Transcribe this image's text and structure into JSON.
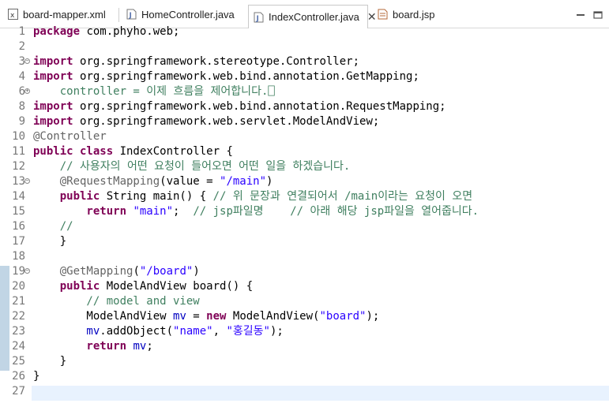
{
  "tabs": [
    {
      "label": "board-mapper.xml",
      "icon": "xml-file-icon",
      "active": false
    },
    {
      "label": "HomeController.java",
      "icon": "java-file-icon",
      "active": false
    },
    {
      "label": "IndexController.java",
      "icon": "java-file-icon",
      "active": true
    },
    {
      "label": "board.jsp",
      "icon": "jsp-file-icon",
      "active": false
    }
  ],
  "close_glyph": "✕",
  "lines": [
    {
      "n": "1",
      "parts": [
        [
          "kw",
          "package"
        ],
        [
          "",
          "com.phyho.web;"
        ]
      ]
    },
    {
      "n": "2",
      "parts": []
    },
    {
      "n": "3",
      "fold": "−",
      "parts": [
        [
          "kw",
          "import"
        ],
        [
          "",
          "org.springframework.stereotype.Controller;"
        ]
      ]
    },
    {
      "n": "4",
      "parts": [
        [
          "kw",
          "import"
        ],
        [
          "",
          "org.springframework.web.bind.annotation.GetMapping;"
        ]
      ]
    },
    {
      "n": "6",
      "fold": "+",
      "parts": [
        [
          "cm",
          "    controller = 이제 흐름을 제어합니다.⎕"
        ]
      ]
    },
    {
      "n": "8",
      "parts": [
        [
          "kw",
          "import"
        ],
        [
          "",
          "org.springframework.web.bind.annotation.RequestMapping;"
        ]
      ]
    },
    {
      "n": "9",
      "parts": [
        [
          "kw",
          "import"
        ],
        [
          "",
          "org.springframework.web.servlet.ModelAndView;"
        ]
      ]
    },
    {
      "n": "10",
      "parts": [
        [
          "ann",
          "@Controller"
        ]
      ]
    },
    {
      "n": "11",
      "parts": [
        [
          "kw",
          "public class"
        ],
        [
          "",
          "IndexController {"
        ]
      ]
    },
    {
      "n": "12",
      "parts": [
        [
          "cm",
          "    // 사용자의 어떤 요청이 들어오면 어떤 일을 하겠습니다."
        ]
      ]
    },
    {
      "n": "13",
      "fold": "−",
      "parts": [
        [
          "ann",
          "    @RequestMapping"
        ],
        [
          "",
          "(value = "
        ],
        [
          "str",
          "\"/main\""
        ],
        [
          "",
          ")"
        ]
      ]
    },
    {
      "n": "14",
      "parts": [
        [
          "kw",
          "    public"
        ],
        [
          "",
          "String main() { "
        ],
        [
          "cm",
          "// 위 문장과 연결되어서 /main이라는 요청이 오면"
        ]
      ]
    },
    {
      "n": "15",
      "parts": [
        [
          "kw",
          "        return"
        ],
        [
          "str",
          " \"main\""
        ],
        [
          "",
          ";  "
        ],
        [
          "cm",
          "// jsp파일명    // 아래 해당 jsp파일을 열어줍니다."
        ]
      ]
    },
    {
      "n": "16",
      "parts": [
        [
          "cm",
          "    //"
        ]
      ]
    },
    {
      "n": "17",
      "parts": [
        [
          "",
          "    }"
        ]
      ]
    },
    {
      "n": "18",
      "parts": []
    },
    {
      "n": "19",
      "fold": "−",
      "parts": [
        [
          "ann",
          "    @GetMapping"
        ],
        [
          "",
          "("
        ],
        [
          "str",
          "\"/board\""
        ],
        [
          "",
          ")"
        ]
      ]
    },
    {
      "n": "20",
      "parts": [
        [
          "kw",
          "    public"
        ],
        [
          "",
          "ModelAndView board() {"
        ]
      ]
    },
    {
      "n": "21",
      "parts": [
        [
          "cm",
          "        // model and view"
        ]
      ]
    },
    {
      "n": "22",
      "parts": [
        [
          "",
          "        ModelAndView "
        ],
        [
          "id",
          "mv"
        ],
        [
          "",
          " = "
        ],
        [
          "kw",
          "new"
        ],
        [
          "",
          " ModelAndView("
        ],
        [
          "str",
          "\"board\""
        ],
        [
          "",
          ");"
        ]
      ]
    },
    {
      "n": "23",
      "parts": [
        [
          "id",
          "        mv"
        ],
        [
          "",
          ".addObject("
        ],
        [
          "str",
          "\"name\""
        ],
        [
          "",
          ", "
        ],
        [
          "str",
          "\"홍길동\""
        ],
        [
          "",
          ");"
        ]
      ]
    },
    {
      "n": "24",
      "parts": [
        [
          "kw",
          "        return"
        ],
        [
          "id",
          " mv"
        ],
        [
          "",
          ";"
        ]
      ]
    },
    {
      "n": "25",
      "parts": [
        [
          "",
          "    }"
        ]
      ]
    },
    {
      "n": "26",
      "parts": [
        [
          "",
          "}"
        ]
      ]
    },
    {
      "n": "27",
      "parts": []
    }
  ],
  "colors": {
    "keyword": "#7f0055",
    "string": "#2a00ff",
    "comment": "#3f7f5f",
    "annotation": "#646464",
    "field": "#0000c0",
    "current_line": "#e8f2fe"
  }
}
